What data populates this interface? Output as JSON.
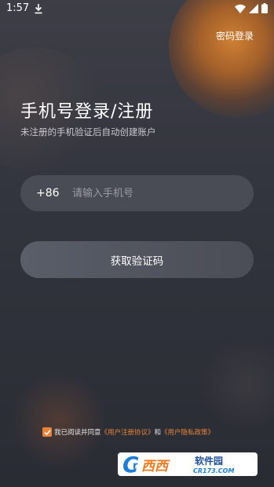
{
  "status_bar": {
    "time": "1:57"
  },
  "header": {
    "password_login": "密码登录"
  },
  "main": {
    "title": "手机号登录/注册",
    "subtitle": "未注册的手机验证后自动创建账户",
    "phone": {
      "country_code": "+86",
      "placeholder": "请输入手机号",
      "value": ""
    },
    "get_code_button": "获取验证码"
  },
  "agreement": {
    "checked": true,
    "prefix": "我已阅读并同意",
    "user_agreement": "《用户注册协议》",
    "and": "和",
    "privacy_policy": "《用户隐私政策》"
  },
  "watermark": {
    "brand": "西西",
    "site_cn": "软件园",
    "site_en": "CR173.COM"
  },
  "colors": {
    "accent": "#e8843a",
    "background": "#33353e",
    "input_bg": "#4a4c55",
    "button_bg": "#555963"
  }
}
